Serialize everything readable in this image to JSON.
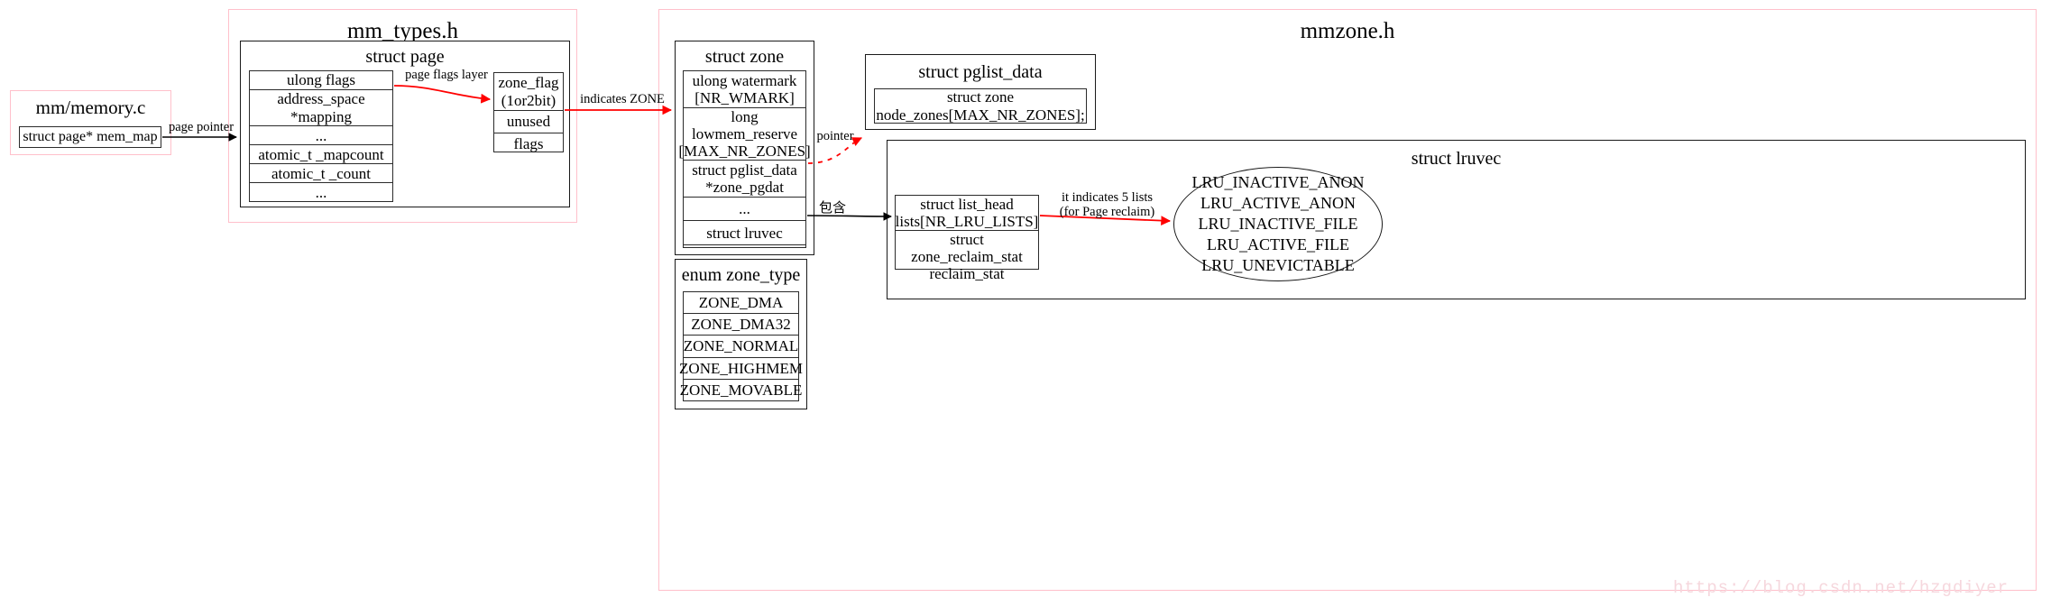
{
  "clusters": {
    "mm_types": {
      "title": "mm_types.h"
    },
    "mmzone": {
      "title": "mmzone.h"
    }
  },
  "boxes": {
    "memory_c": {
      "title": "mm/memory.c",
      "field": "struct page* mem_map"
    },
    "struct_page": {
      "title": "struct page",
      "fields": [
        "ulong flags",
        "address_space *mapping",
        "...",
        "atomic_t _mapcount",
        "atomic_t _count",
        "..."
      ]
    },
    "zone_flag": {
      "fields": [
        "zone_flag\n(1or2bit)",
        "unused",
        "flags"
      ]
    },
    "struct_zone": {
      "title": "struct zone",
      "fields": [
        "ulong watermark\n[NR_WMARK]",
        "long lowmem_reserve\n[MAX_NR_ZONES]",
        "struct pglist_data\n*zone_pgdat",
        "...",
        "struct lruvec",
        "..."
      ]
    },
    "enum_zone_type": {
      "title": "enum zone_type",
      "fields": [
        "ZONE_DMA",
        "ZONE_DMA32",
        "ZONE_NORMAL",
        "ZONE_HIGHMEM",
        "ZONE_MOVABLE"
      ]
    },
    "pglist_data": {
      "title": "struct pglist_data",
      "fields": [
        "struct zone\nnode_zones[MAX_NR_ZONES];"
      ]
    },
    "lruvec": {
      "title": "struct lruvec",
      "fields": [
        "struct list_head\nlists[NR_LRU_LISTS]",
        "struct zone_reclaim_stat\nreclaim_stat"
      ]
    },
    "lru_lists": {
      "text": "LRU_INACTIVE_ANON\nLRU_ACTIVE_ANON\nLRU_INACTIVE_FILE\nLRU_ACTIVE_FILE\nLRU_UNEVICTABLE"
    }
  },
  "edge_labels": {
    "page_pointer": "page pointer",
    "page_flags_layer": "page flags layer",
    "indicates_zone": "indicates ZONE",
    "pointer": "pointer",
    "contains": "包含",
    "five_lists": "it indicates 5 lists\n(for Page reclaim)"
  },
  "watermark": "https://blog.csdn.net/hzgdiyer",
  "colors": {
    "cluster_border": "#ffc0cb",
    "box_border": "#1a1a1a",
    "red_edge": "#ff0000",
    "black_edge": "#000000",
    "watermark": "#f6d7dd"
  }
}
